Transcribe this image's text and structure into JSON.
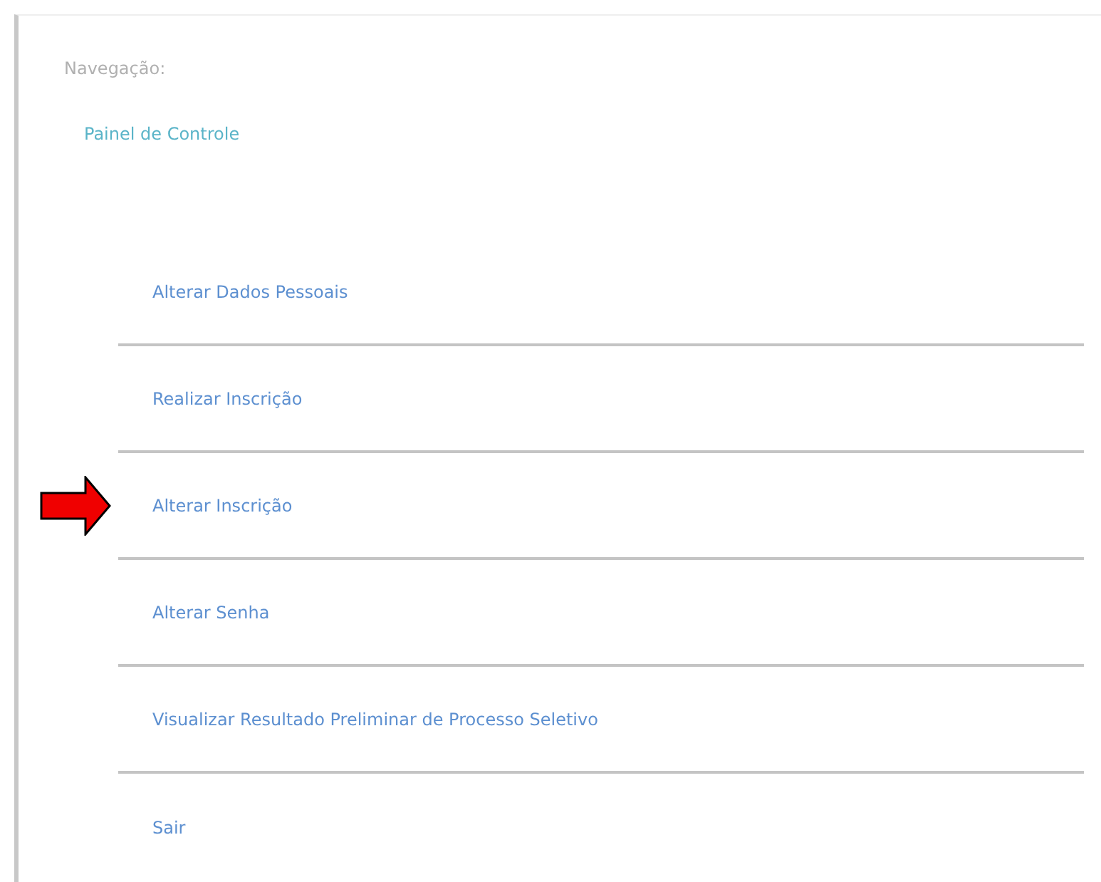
{
  "navigation": {
    "heading": "Navegação:",
    "link": "Painel de Controle"
  },
  "menu": [
    {
      "label": "Alterar Dados Pessoais",
      "marked": false
    },
    {
      "label": "Realizar Inscrição",
      "marked": false
    },
    {
      "label": "Alterar Inscrição",
      "marked": true
    },
    {
      "label": "Alterar Senha",
      "marked": false
    },
    {
      "label": "Visualizar Resultado Preliminar de Processo Seletivo",
      "marked": false
    },
    {
      "label": "Sair",
      "marked": false
    }
  ]
}
